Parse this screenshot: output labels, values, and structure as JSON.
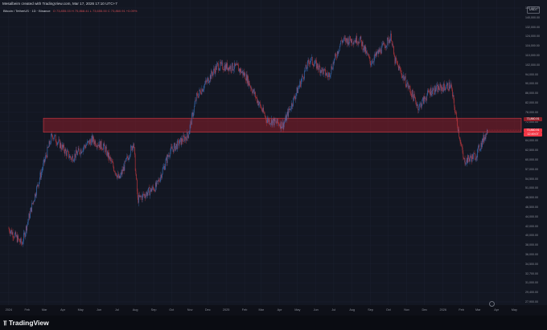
{
  "header": {
    "caption": "Mesalbeim created with TradingView.com, Mar 17, 2026 17:10 UTC+7",
    "symbol_line": "Bitcoin / TetherUS · 1D · Binance",
    "ohlc_line": "O 73,855.03 H 75,868.41 L 73,655.00 C 73,860.91 +0.09%",
    "currency": "USDT"
  },
  "colors": {
    "background": "#131722",
    "candle_up": "#3a6fb8",
    "candle_down": "#c2393f",
    "zone_fill": "#8c1e2a",
    "zone_border": "#d23a45",
    "last_price_tag": "#f23645",
    "zone_price_tag": "#8f1e28"
  },
  "price_tags": {
    "last_price": "73,860.91",
    "zone_price": "73,860.91",
    "countdown": "12:49:07"
  },
  "footer": {
    "brand": "TradingView",
    "brand_icon": "tradingview-logo-icon"
  },
  "chart_data": {
    "type": "candlestick",
    "title": "",
    "symbol": "Bitcoin / TetherUS",
    "interval": "1D",
    "exchange": "Binance",
    "x_ticks": [
      "2024",
      "Feb",
      "Mar",
      "Apr",
      "May",
      "Jun",
      "Jul",
      "Aug",
      "Sep",
      "Oct",
      "Nov",
      "Dec",
      "2025",
      "Feb",
      "Mar",
      "Apr",
      "May",
      "Jun",
      "Jul",
      "Aug",
      "Sep",
      "Oct",
      "Nov",
      "Dec",
      "2026",
      "Feb",
      "Mar",
      "Apr",
      "May"
    ],
    "y_ticks": [
      "148,000.00",
      "140,000.00",
      "132,000.00",
      "124,000.00",
      "116,000.00",
      "110,000.00",
      "102,000.00",
      "94,000.00",
      "90,000.00",
      "86,000.00",
      "82,000.00",
      "78,000.00",
      "72,000.00",
      "68,000.00",
      "64,000.00",
      "62,500.00",
      "60,000.00",
      "57,000.00",
      "54,500.00",
      "51,000.00",
      "48,500.00",
      "46,500.00",
      "44,000.00",
      "42,000.00",
      "40,000.00",
      "38,000.00",
      "36,000.00",
      "34,500.00",
      "32,700.00",
      "31,000.00",
      "29,400.00",
      "27,900.00"
    ],
    "ylim": [
      27900,
      148000
    ],
    "log_scale": true,
    "grid": true,
    "resistance_zone": [
      73000,
      79000
    ],
    "series_trend": [
      {
        "date": "2024-01-01",
        "close": 42500
      },
      {
        "date": "2024-01-23",
        "close": 39000
      },
      {
        "date": "2024-02-15",
        "close": 52000
      },
      {
        "date": "2024-03-14",
        "close": 72000
      },
      {
        "date": "2024-04-15",
        "close": 63000
      },
      {
        "date": "2024-05-20",
        "close": 70000
      },
      {
        "date": "2024-06-10",
        "close": 67000
      },
      {
        "date": "2024-07-05",
        "close": 56000
      },
      {
        "date": "2024-07-29",
        "close": 69000
      },
      {
        "date": "2024-08-05",
        "close": 50000
      },
      {
        "date": "2024-09-06",
        "close": 54000
      },
      {
        "date": "2024-09-28",
        "close": 65500
      },
      {
        "date": "2024-10-29",
        "close": 72000
      },
      {
        "date": "2024-11-12",
        "close": 89000
      },
      {
        "date": "2024-12-17",
        "close": 106000
      },
      {
        "date": "2025-01-20",
        "close": 105000
      },
      {
        "date": "2025-02-03",
        "close": 100000
      },
      {
        "date": "2025-03-10",
        "close": 78500
      },
      {
        "date": "2025-04-07",
        "close": 76000
      },
      {
        "date": "2025-05-22",
        "close": 110000
      },
      {
        "date": "2025-06-22",
        "close": 100000
      },
      {
        "date": "2025-07-14",
        "close": 122000
      },
      {
        "date": "2025-08-14",
        "close": 123000
      },
      {
        "date": "2025-09-01",
        "close": 108000
      },
      {
        "date": "2025-10-06",
        "close": 125000
      },
      {
        "date": "2025-10-11",
        "close": 110000
      },
      {
        "date": "2025-11-21",
        "close": 84000
      },
      {
        "date": "2025-12-10",
        "close": 92000
      },
      {
        "date": "2026-01-14",
        "close": 95000
      },
      {
        "date": "2026-02-05",
        "close": 62000
      },
      {
        "date": "2026-02-25",
        "close": 64000
      },
      {
        "date": "2026-03-17",
        "close": 73860
      }
    ]
  }
}
